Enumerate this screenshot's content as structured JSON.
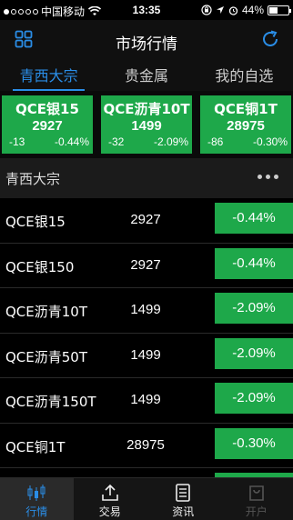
{
  "status_bar": {
    "carrier": "中国移动",
    "time": "13:35",
    "battery": "44%",
    "battery_level": 0.44
  },
  "nav": {
    "title": "市场行情"
  },
  "tabs": [
    {
      "label": "青西大宗",
      "active": true
    },
    {
      "label": "贵金属",
      "active": false
    },
    {
      "label": "我的自选",
      "active": false
    }
  ],
  "cards": [
    {
      "name": "QCE银15",
      "price": "2927",
      "change": "-13",
      "percent": "-0.44%"
    },
    {
      "name": "QCE沥青10T",
      "price": "1499",
      "change": "-32",
      "percent": "-2.09%"
    },
    {
      "name": "QCE铜1T",
      "price": "28975",
      "change": "-86",
      "percent": "-0.30%"
    }
  ],
  "section": {
    "label": "青西大宗"
  },
  "rows": [
    {
      "name": "QCE银15",
      "price": "2927",
      "percent": "-0.44%"
    },
    {
      "name": "QCE银150",
      "price": "2927",
      "percent": "-0.44%"
    },
    {
      "name": "QCE沥青10T",
      "price": "1499",
      "percent": "-2.09%"
    },
    {
      "name": "QCE沥青50T",
      "price": "1499",
      "percent": "-2.09%"
    },
    {
      "name": "QCE沥青150T",
      "price": "1499",
      "percent": "-2.09%"
    },
    {
      "name": "QCE铜1T",
      "price": "28975",
      "percent": "-0.30%"
    },
    {
      "name": "",
      "price": "",
      "percent": ""
    }
  ],
  "tabbar": [
    {
      "label": "行情",
      "icon": "chart-icon",
      "active": true
    },
    {
      "label": "交易",
      "icon": "upload-icon",
      "active": false
    },
    {
      "label": "资讯",
      "icon": "news-icon",
      "active": false
    },
    {
      "label": "开户",
      "icon": "bag-icon",
      "active": false,
      "disabled": true
    }
  ],
  "colors": {
    "accent": "#2a8de6",
    "down_green": "#1ea84a",
    "background": "#000000"
  }
}
